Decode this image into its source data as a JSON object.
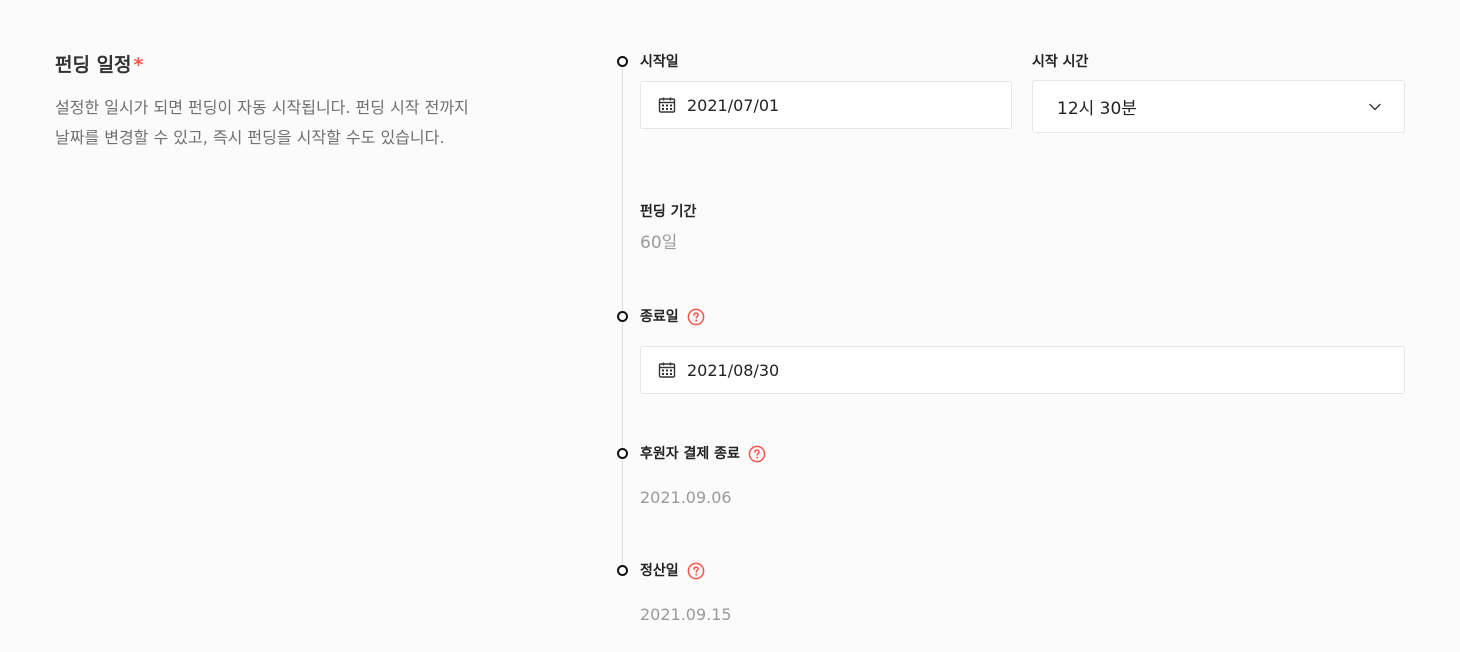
{
  "section": {
    "title": "펀딩 일정",
    "required_mark": "*",
    "description_lines": [
      "설정한 일시가 되면 펀딩이 자동 시작됩니다. 펀딩 시작 전까지",
      "날짜를 변경할 수 있고, 즉시 펀딩을 시작할 수도 있습니다."
    ]
  },
  "start": {
    "date_label": "시작일",
    "date_value": "2021/07/01",
    "time_label": "시작 시간",
    "time_value": "12시 30분"
  },
  "duration": {
    "label": "펀딩 기간",
    "value": "60일"
  },
  "end": {
    "label": "종료일",
    "date_value": "2021/08/30"
  },
  "payment_end": {
    "label": "후원자 결제 종료",
    "value": "2021.09.06"
  },
  "settlement": {
    "label": "정산일",
    "value": "2021.09.15"
  },
  "icons": {
    "calendar": "calendar-icon",
    "help": "help-circle-icon",
    "chevron": "chevron-down-icon"
  },
  "colors": {
    "accent_red": "#f55549",
    "background": "#fbfbfb",
    "muted_text": "#9a9a9a"
  }
}
